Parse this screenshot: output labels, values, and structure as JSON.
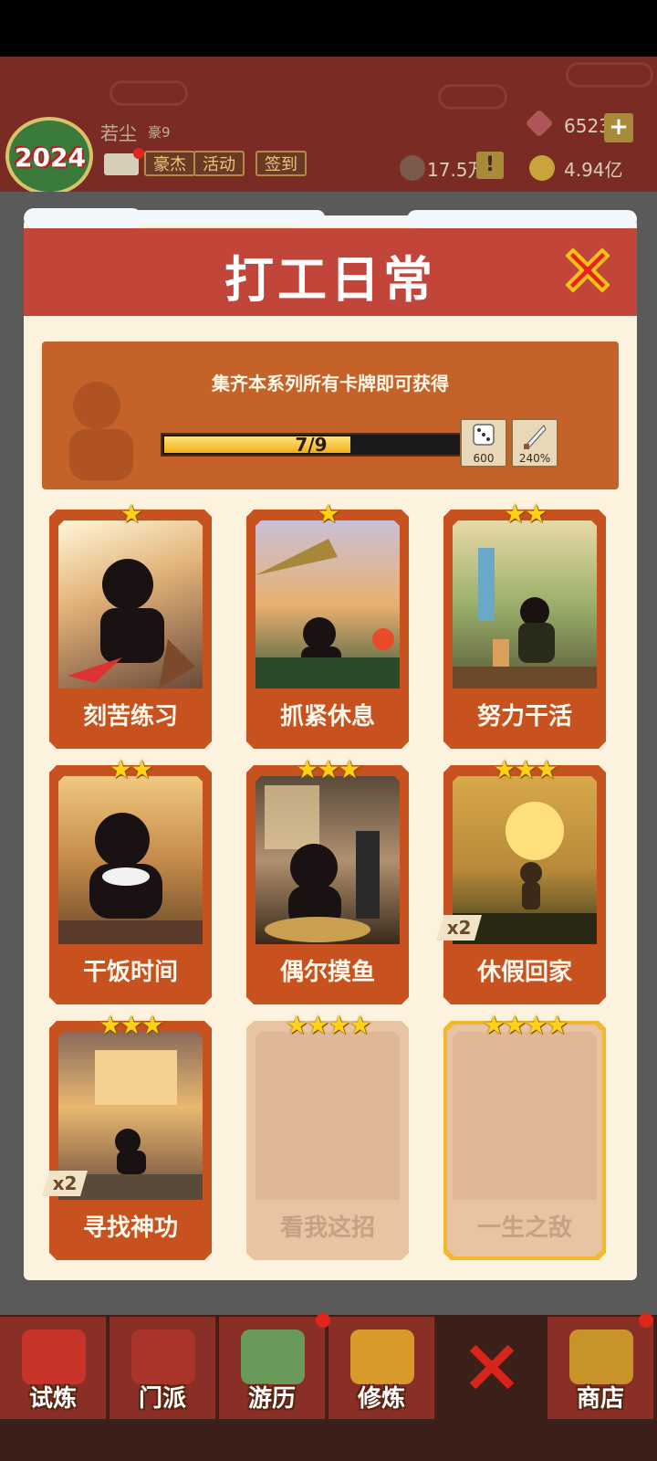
{
  "player": {
    "avatar_year": "2024",
    "name": "若尘",
    "level": "豪9",
    "buttons": [
      "豪杰",
      "活动",
      "签到"
    ]
  },
  "resources": {
    "gems": "6523",
    "power": "17.5万",
    "coins": "4.94亿",
    "plus": "+",
    "warn": "!"
  },
  "dialog": {
    "title": "打工日常",
    "banner_text": "集齐本系列所有卡牌即可获得",
    "progress_text": "7/9",
    "progress": 0.7778,
    "rewards": [
      {
        "icon": "dice-icon",
        "value": "600"
      },
      {
        "icon": "blade-icon",
        "value": "240%"
      }
    ]
  },
  "cards": [
    {
      "label": "刻苦练习",
      "stars": "★",
      "star_count": 1,
      "owned": true
    },
    {
      "label": "抓紧休息",
      "stars": "★",
      "star_count": 1,
      "owned": true
    },
    {
      "label": "努力干活",
      "stars": "★★",
      "star_count": 2,
      "owned": true
    },
    {
      "label": "干饭时间",
      "stars": "★★",
      "star_count": 2,
      "owned": true
    },
    {
      "label": "偶尔摸鱼",
      "stars": "★★★",
      "star_count": 3,
      "owned": true
    },
    {
      "label": "休假回家",
      "stars": "★★★",
      "star_count": 3,
      "owned": true,
      "badge": "x2"
    },
    {
      "label": "寻找神功",
      "stars": "★★★",
      "star_count": 3,
      "owned": true,
      "badge": "x2"
    },
    {
      "label": "看我这招",
      "stars": "★★★★",
      "star_count": 4,
      "owned": false
    },
    {
      "label": "一生之敌",
      "stars": "★★★★",
      "star_count": 4,
      "owned": false
    }
  ],
  "nav": [
    {
      "label": "试炼",
      "icon": "firecracker-icon"
    },
    {
      "label": "门派",
      "icon": "temple-icon"
    },
    {
      "label": "游历",
      "icon": "mountain-icon"
    },
    {
      "label": "修炼",
      "icon": "scroll-book-icon"
    },
    {
      "label": "",
      "icon": "crossed-swords-icon"
    },
    {
      "label": "商店",
      "icon": "shop-icon"
    }
  ],
  "colors": {
    "header_red": "#c2453a",
    "card_orange": "#c7521f",
    "star_gold": "#ffd21a",
    "panel_cream": "#fcf2dd"
  }
}
